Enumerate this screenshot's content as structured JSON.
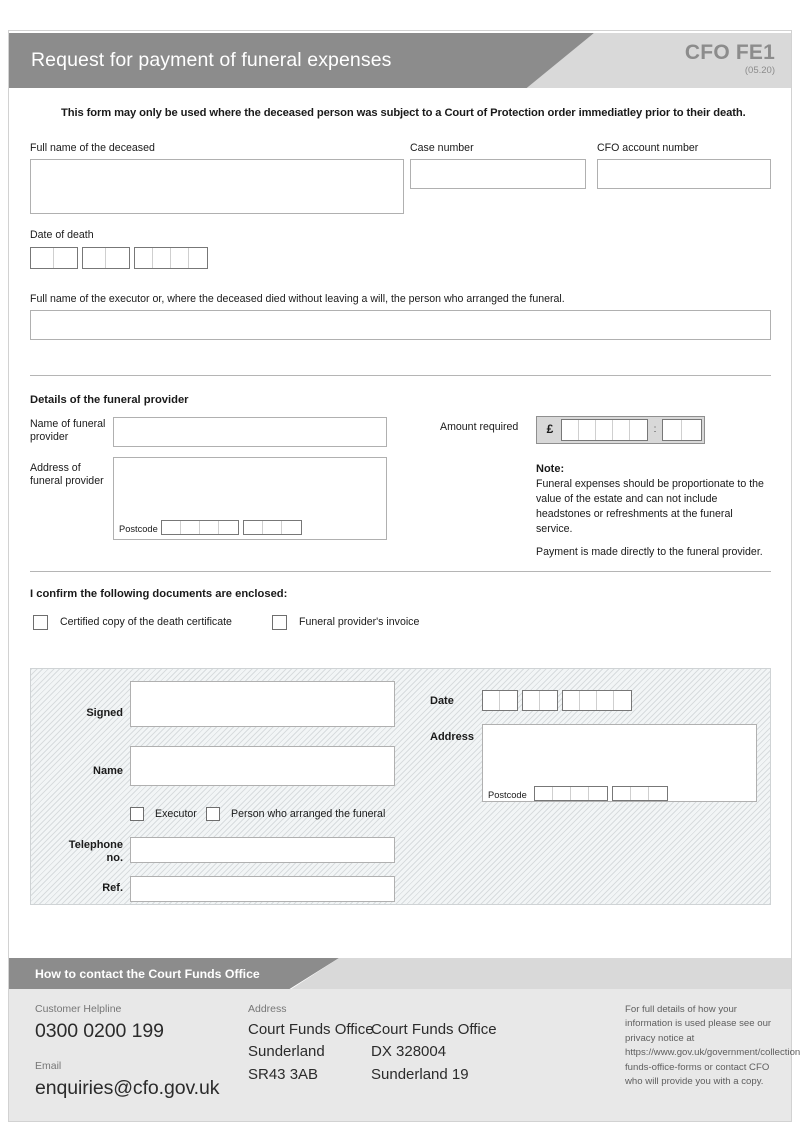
{
  "header": {
    "title": "Request for payment of funeral expenses",
    "form_code": "CFO FE1",
    "form_version": "(05.20)"
  },
  "notice": "This form may only be used where the deceased person was subject to a Court of Protection order immediatley prior to their death.",
  "deceased": {
    "full_name_label": "Full name of the deceased",
    "full_name_value": "",
    "case_number_label": "Case number",
    "case_number_value": "",
    "cfo_account_label": "CFO account number",
    "cfo_account_value": "",
    "date_of_death_label": "Date of death"
  },
  "executor": {
    "label": "Full name of the executor or, where the deceased died without leaving a will, the person who arranged the funeral.",
    "value": ""
  },
  "provider": {
    "section_title": "Details of the funeral provider",
    "name_label": "Name of funeral provider",
    "name_value": "",
    "address_label": "Address of funeral provider",
    "address_value": "",
    "postcode_label": "Postcode",
    "amount_label": "Amount required",
    "currency_symbol": "£",
    "amount_pounds": "",
    "amount_pence": "",
    "note_title": "Note:",
    "note_line1": "Funeral expenses should be proportionate to the value of the estate and can not include headstones or refreshments at the funeral service.",
    "note_line2": "Payment is made directly to the funeral provider."
  },
  "documents": {
    "title": "I confirm the following documents are enclosed:",
    "items": [
      {
        "label": "Certified copy of the death certificate",
        "checked": false
      },
      {
        "label": "Funeral provider's invoice",
        "checked": false
      }
    ]
  },
  "declaration": {
    "signed_label": "Signed",
    "signed_value": "",
    "name_label": "Name",
    "name_value": "",
    "role_options": [
      {
        "label": "Executor",
        "checked": false
      },
      {
        "label": "Person who arranged the funeral",
        "checked": false
      }
    ],
    "telephone_label": "Telephone no.",
    "telephone_value": "",
    "ref_label": "Ref.",
    "ref_value": "",
    "date_label": "Date",
    "address_label": "Address",
    "address_value": "",
    "postcode_label": "Postcode"
  },
  "footer": {
    "band_title": "How to contact the Court Funds Office",
    "helpline_caption": "Customer Helpline",
    "helpline_number": "0300 0200 199",
    "email_caption": "Email",
    "email_address": "enquiries@cfo.gov.uk",
    "address_caption": "Address",
    "address_col1_line1": "Court Funds Office",
    "address_col1_line2": "Sunderland",
    "address_col1_line3": "SR43 3AB",
    "address_col2_line1": "Court Funds Office",
    "address_col2_line2": "DX 328004",
    "address_col2_line3": "Sunderland 19",
    "privacy_notice": "For full details of how your information is used please see our privacy notice at https://www.gov.uk/government/collections/court-funds-office-forms or contact CFO who will provide you with a copy."
  },
  "colors": {
    "band_dark": "#8c8c8c",
    "band_light": "#d9d9d9",
    "footer_bg": "#e8e8e8",
    "rule": "#b5b5b5"
  }
}
